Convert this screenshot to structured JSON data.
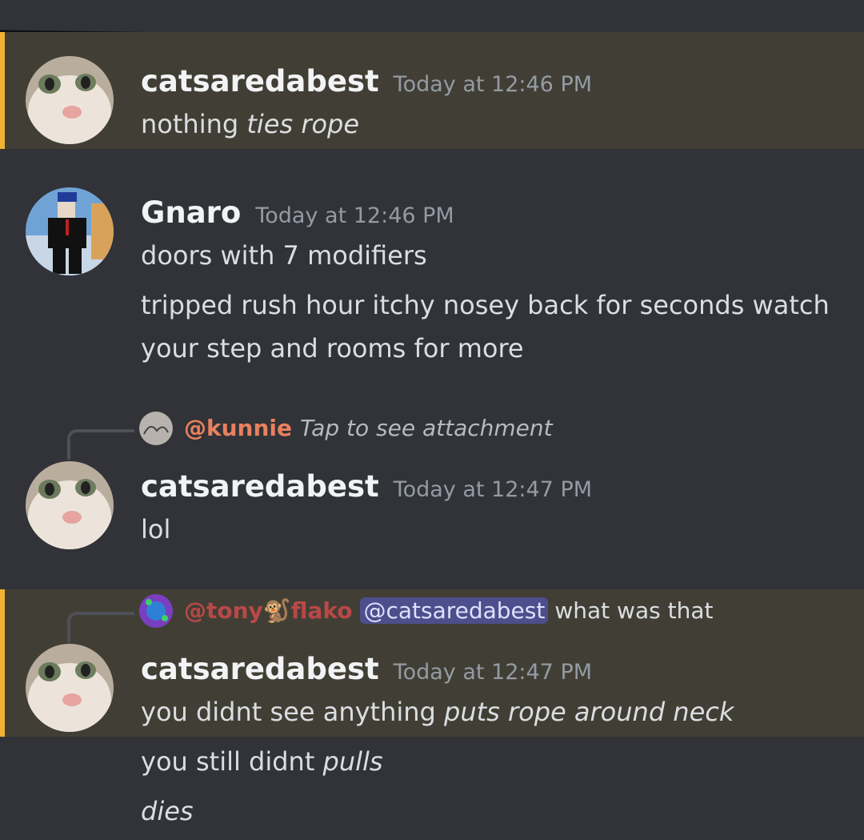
{
  "messages": [
    {
      "username": "catsaredabest",
      "timestamp": "Today at 12:46 PM",
      "text_plain": "nothing ",
      "text_italic": "ties rope"
    },
    {
      "username": "Gnaro",
      "timestamp": "Today at 12:46 PM",
      "line1": "doors with 7 modifiers",
      "line2": "tripped rush hour itchy nosey back for seconds watch",
      "line3": "your step and rooms for more"
    },
    {
      "reply": {
        "user": "@kunnie",
        "text": "Tap to see attachment"
      },
      "username": "catsaredabest",
      "timestamp": "Today at 12:47 PM",
      "text": "lol"
    },
    {
      "reply": {
        "user_part1": "@tony",
        "emoji": "🐒",
        "user_part2": "flako",
        "mention": "@catsaredabest",
        "text": "what was that"
      },
      "username": "catsaredabest",
      "timestamp": "Today at 12:47 PM",
      "line1_plain": "you didnt see anything ",
      "line1_italic": "puts rope around neck",
      "line2_plain": "you still didnt ",
      "line2_italic": "pulls",
      "line3_italic": "dies"
    }
  ],
  "colors": {
    "background": "#313338",
    "highlight": "#413f35",
    "highlight_bar": "#f0b232",
    "username": "#f2f3f5",
    "timestamp": "#949ba4",
    "reply_user": "#e9805e",
    "mention_bg": "#4c4f8c"
  }
}
